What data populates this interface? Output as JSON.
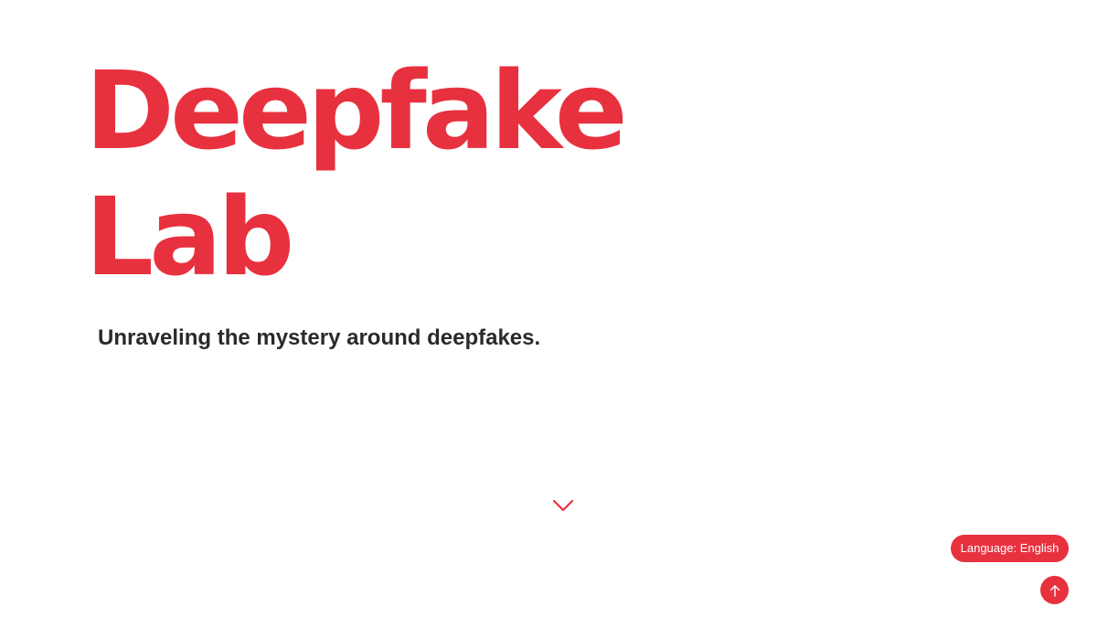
{
  "hero": {
    "title_line1": "Deepfake",
    "title_line2": "Lab",
    "tagline": "Unraveling the mystery around deepfakes."
  },
  "controls": {
    "scroll_down_icon": "chevron-down-icon",
    "language_label": "Language: English",
    "back_to_top_icon": "arrow-up-icon"
  },
  "colors": {
    "accent": "#e8313f",
    "text": "#2a2a2a",
    "background": "#ffffff"
  }
}
